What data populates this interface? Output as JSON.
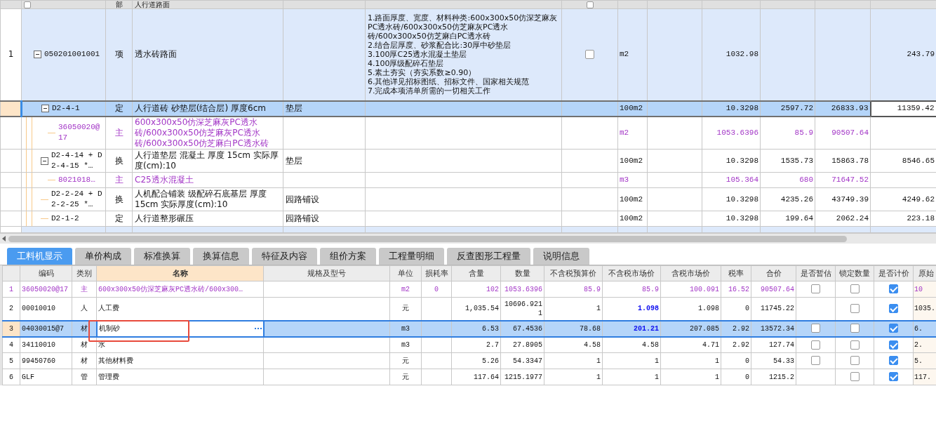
{
  "top_grid": {
    "section": {
      "type": "部",
      "name": "人行道路面",
      "checked": false,
      "flag_checked": false
    },
    "rows": [
      {
        "num": "1",
        "code": "050201001001",
        "type": "项",
        "name": "透水砖路面",
        "kind": "item",
        "expanded": true,
        "selected": false,
        "checked": false,
        "features": [
          "1.路面厚度、宽度、材料种类:600x300x50仿深芝麻灰PC透水砖/600x300x50仿芝麻灰PC透水砖/600x300x50仿芝麻白PC透水砖",
          "2.结合层厚度、砂浆配合比:30厚中砂垫层",
          "3.100厚C25透水混凝土垫层",
          "4.100厚级配碎石垫层",
          "5.素土夯实（夯实系数≥0.90）",
          "6.其他详见招标图纸、招标文件、国家相关规范",
          "7.完成本项清单所需的一切相关工作"
        ],
        "column_8": "m2",
        "column_10": "1032.98",
        "column_13": "243.79",
        "children": [
          {
            "code": "D2-4-1",
            "type": "定",
            "name": "人行道砖 砂垫层(结合层) 厚度6cm",
            "spec": "垫层",
            "kind": "norm",
            "expanded": true,
            "selected": true,
            "column_8": "100m2",
            "column_10": "10.3298",
            "column_11": "2597.72",
            "column_12": "26833.93",
            "column_13": "11359.42",
            "children": [
              {
                "code": "36050020@17",
                "type": "主",
                "name": "600x300x50仿深芝麻灰PC透水砖/600x300x50仿芝麻灰PC透水砖/600x300x50仿芝麻白PC透水砖",
                "kind": "main",
                "selected": false,
                "column_8": "m2",
                "column_10": "1053.6396",
                "column_11": "85.9",
                "column_12": "90507.64"
              }
            ]
          },
          {
            "code": "D2-4-14 + D2-4-15 *…",
            "type": "换",
            "name": "人行道垫层 混凝土 厚度 15cm  实际厚度(cm):10",
            "spec": "垫层",
            "kind": "norm",
            "expanded": true,
            "selected": false,
            "column_8": "100m2",
            "column_10": "10.3298",
            "column_11": "1535.73",
            "column_12": "15863.78",
            "column_13": "8546.65",
            "children": [
              {
                "code": "8021018…",
                "type": "主",
                "name": "C25透水混凝土",
                "kind": "main",
                "selected": false,
                "column_8": "m3",
                "column_10": "105.364",
                "column_11": "680",
                "column_12": "71647.52"
              }
            ]
          },
          {
            "code": "D2-2-24 + D2-2-25 *…",
            "type": "换",
            "name": "人机配合铺装 级配碎石底基层 厚度 15cm  实际厚度(cm):10",
            "spec": "园路铺设",
            "kind": "norm",
            "selected": false,
            "column_8": "100m2",
            "column_10": "10.3298",
            "column_11": "4235.26",
            "column_12": "43749.39",
            "column_13": "4249.62"
          },
          {
            "code": "D2-1-2",
            "type": "定",
            "name": "人行道整形碾压",
            "spec": "园路铺设",
            "kind": "norm",
            "selected": false,
            "column_8": "100m2",
            "column_10": "10.3298",
            "column_11": "199.64",
            "column_12": "2062.24",
            "column_13": "223.18"
          }
        ]
      }
    ]
  },
  "tabs": [
    {
      "label": "工料机显示",
      "selected": true
    },
    {
      "label": "单价构成",
      "selected": false
    },
    {
      "label": "标准换算",
      "selected": false
    },
    {
      "label": "换算信息",
      "selected": false
    },
    {
      "label": "特征及内容",
      "selected": false
    },
    {
      "label": "组价方案",
      "selected": false
    },
    {
      "label": "工程量明细",
      "selected": false
    },
    {
      "label": "反查图形工程量",
      "selected": false
    },
    {
      "label": "说明信息",
      "selected": false
    }
  ],
  "resource_grid": {
    "columns": [
      {
        "label": "编码",
        "selected": false
      },
      {
        "label": "类别",
        "selected": false
      },
      {
        "label": "名称",
        "selected": true
      },
      {
        "label": "规格及型号",
        "selected": false
      },
      {
        "label": "单位",
        "selected": false
      },
      {
        "label": "损耗率",
        "selected": false
      },
      {
        "label": "含量",
        "selected": false
      },
      {
        "label": "数量",
        "selected": false
      },
      {
        "label": "不含税预算价",
        "selected": false
      },
      {
        "label": "不含税市场价",
        "selected": false
      },
      {
        "label": "含税市场价",
        "selected": false
      },
      {
        "label": "税率",
        "selected": false
      },
      {
        "label": "合价",
        "selected": false
      },
      {
        "label": "是否暂估",
        "selected": false
      },
      {
        "label": "锁定数量",
        "selected": false
      },
      {
        "label": "是否计价",
        "selected": false
      },
      {
        "label": "原始",
        "selected": false
      }
    ],
    "rows": [
      {
        "num": "1",
        "code": "36050020@17",
        "type": "主",
        "kind": "main",
        "name": "600x300x50仿深芝麻灰PC透水砖/600x300…",
        "unit": "m2",
        "loss": "0",
        "content": "102",
        "quantity": "1053.6396",
        "budget_price": "85.9",
        "market_price": "85.9",
        "market_price_changed": false,
        "tax_price": "100.091",
        "tax_rate": "16.52",
        "total": "90507.64",
        "estimate": false,
        "locked": false,
        "priced": true,
        "original": "10",
        "selected": false
      },
      {
        "num": "2",
        "code": "00010010",
        "type": "人",
        "kind": "resource",
        "name": "人工费",
        "unit": "元",
        "content": "1,035.54",
        "quantity": "10696.9211",
        "budget_price": "1",
        "market_price": "1.098",
        "market_price_changed": true,
        "tax_price": "1.098",
        "tax_rate": "0",
        "total": "11745.22",
        "locked": false,
        "priced": true,
        "original": "1035.",
        "selected": false
      },
      {
        "num": "3",
        "code": "04030015@7",
        "type": "材",
        "kind": "resource",
        "name": "机制砂",
        "unit": "m3",
        "content": "6.53",
        "quantity": "67.4536",
        "budget_price": "78.68",
        "market_price": "201.21",
        "market_price_changed": true,
        "tax_price": "207.085",
        "tax_rate": "2.92",
        "total": "13572.34",
        "estimate": false,
        "locked": false,
        "priced": true,
        "original": "6.",
        "selected": true
      },
      {
        "num": "4",
        "code": "34110010",
        "type": "材",
        "kind": "resource",
        "name": "水",
        "unit": "m3",
        "content": "2.7",
        "quantity": "27.8905",
        "budget_price": "4.58",
        "market_price": "4.58",
        "market_price_changed": false,
        "tax_price": "4.71",
        "tax_rate": "2.92",
        "total": "127.74",
        "estimate": false,
        "locked": false,
        "priced": true,
        "original": "2.",
        "selected": false
      },
      {
        "num": "5",
        "code": "99450760",
        "type": "材",
        "kind": "resource",
        "name": "其他材料费",
        "unit": "元",
        "content": "5.26",
        "quantity": "54.3347",
        "budget_price": "1",
        "market_price": "1",
        "market_price_changed": false,
        "tax_price": "1",
        "tax_rate": "0",
        "total": "54.33",
        "estimate": false,
        "locked": false,
        "priced": true,
        "original": "5.",
        "selected": false
      },
      {
        "num": "6",
        "code": "GLF",
        "type": "管",
        "kind": "resource",
        "name": "管理费",
        "unit": "元",
        "content": "117.64",
        "quantity": "1215.1977",
        "budget_price": "1",
        "market_price": "1",
        "market_price_changed": false,
        "tax_price": "1",
        "tax_rate": "0",
        "total": "1215.2",
        "locked": false,
        "priced": true,
        "original": "117.",
        "selected": false
      }
    ]
  }
}
